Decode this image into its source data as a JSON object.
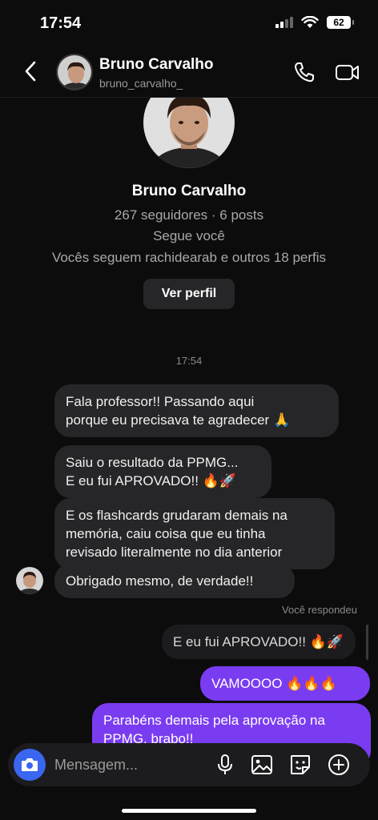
{
  "status": {
    "time": "17:54",
    "battery": "62"
  },
  "header": {
    "name": "Bruno Carvalho",
    "username": "bruno_carvalho_"
  },
  "profile": {
    "name": "Bruno Carvalho",
    "stats": "267 seguidores · 6 posts",
    "follows_you": "Segue você",
    "mutuals": "Vocês seguem rachidearab e outros 18 perfis",
    "view_profile": "Ver perfil"
  },
  "chat": {
    "timestamp": "17:54",
    "incoming": [
      "Fala professor!! Passando aqui\nporque eu precisava te agradecer 🙏",
      "Saiu o resultado da PPMG...\nE eu fui APROVADO!! 🔥🚀",
      "E os flashcards grudaram demais na\nmemória, caiu coisa que eu tinha\nrevisado literalmente no dia anterior",
      "Obrigado mesmo, de verdade!!"
    ],
    "replied_label": "Você respondeu",
    "replied_quote": "E eu fui APROVADO!! 🔥🚀",
    "outgoing": [
      "VAMOOOO 🔥🔥🔥",
      "Parabéns demais pela aprovação na\nPPMG, brabo!!"
    ]
  },
  "composer": {
    "placeholder": "Mensagem..."
  },
  "colors": {
    "accent": "#7a3cf0",
    "camera": "#3a66f0",
    "bubble_in": "#262628"
  }
}
